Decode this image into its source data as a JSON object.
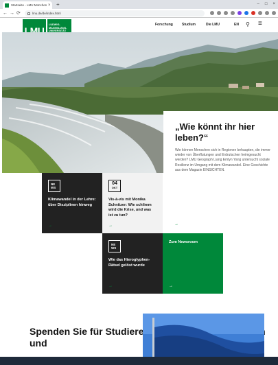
{
  "browser": {
    "tab_title": "Startseite - LMU München",
    "tab_close": "×",
    "new_tab": "+",
    "url": "lmu.de/de/index.html",
    "back": "←",
    "forward": "→",
    "reload": "⟳",
    "window_controls": [
      "–",
      "□",
      "×"
    ]
  },
  "header": {
    "logo_mark": "LMU",
    "logo_lines": [
      "LUDWIG-",
      "MAXIMILIANS-",
      "UNIVERSITÄT",
      "MÜNCHEN"
    ],
    "nav": [
      "Forschung",
      "Studium",
      "Die LMU"
    ],
    "lang": "EN",
    "search_icon": "⚲",
    "menu_icon": "≡"
  },
  "hero": {
    "title": "„Wie könnt ihr hier leben?“",
    "text": "Wie können Menschen sich in Regionen behaupten, die immer wieder von Überflutungen und Erdrutschen heimgesucht werden? LMU Geograph Liang Emlyn Yang untersucht soziale Resilienz im Umgang mit dem Klimawandel. Eine Geschichte aus dem Magazin EINSICHTEN.",
    "arrow": "→"
  },
  "tiles": [
    {
      "badge": "NE WS",
      "title": "Klimawandel in der Lehre: über Disziplinen hinweg",
      "arrow": "→"
    },
    {
      "day": "04",
      "month": "OKT",
      "title": "Vis-à-vis mit Monika Schnitzer: Wie schlimm wird die Krise, und was ist zu tun?",
      "arrow": "→"
    },
    {
      "badge": "NE WS",
      "title": "Wie das Hieroglyphen-Rätsel gelöst wurde",
      "arrow": "→"
    },
    {
      "title": "Zum Newsroom",
      "arrow": "→"
    }
  ],
  "donate": {
    "title": "Spenden Sie für Studierende, Wissenschaftlerinnen und"
  },
  "colors": {
    "brand_green": "#00883a",
    "dark_tile": "#222222",
    "light_tile": "#f2f2f2"
  }
}
